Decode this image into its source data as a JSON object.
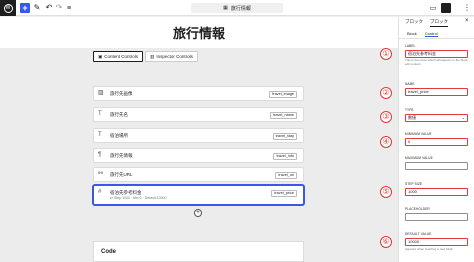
{
  "toolbar": {
    "add_label": "+",
    "document_title": "旅行情報",
    "document_icon": "template-icon"
  },
  "page": {
    "title": "旅行情報"
  },
  "control_tabs": [
    {
      "label": "Content Controls"
    },
    {
      "label": "Inspector Controls"
    }
  ],
  "fields": [
    {
      "label": "旅行先画像",
      "name": "travel_image",
      "icon": "image-icon"
    },
    {
      "label": "旅行先名",
      "name": "travel_name",
      "icon": "text-icon"
    },
    {
      "label": "宿泊場所",
      "name": "travel_stay",
      "icon": "text-icon"
    },
    {
      "label": "旅行先情報",
      "name": "travel_info",
      "icon": "paragraph-icon"
    },
    {
      "label": "旅行先URL",
      "name": "travel_url",
      "icon": "link-icon"
    },
    {
      "label": "宿泊先参考料金",
      "name": "travel_price",
      "icon": "number-icon",
      "sub": "⇄ Step:1000 · Min:0 · Default:10000",
      "selected": true
    }
  ],
  "code_section": {
    "title": "Code"
  },
  "sidebar": {
    "tabs": [
      "ブロック",
      "ブロック"
    ],
    "subtabs": [
      "Block",
      "Control"
    ],
    "label_field": {
      "label": "LABEL",
      "value": "宿泊先参考料金",
      "help": "This is the name which will appear on the block edit content"
    },
    "name_field": {
      "label": "NAME",
      "value": "travel_price"
    },
    "type_field": {
      "label": "TYPE",
      "value": "数値"
    },
    "min_field": {
      "label": "MINIMUM VALUE",
      "value": "0"
    },
    "max_field": {
      "label": "MAXIMUM VALUE",
      "value": ""
    },
    "step_field": {
      "label": "STEP SIZE",
      "value": "1000"
    },
    "placeholder_field": {
      "label": "PLACEHOLDER",
      "value": ""
    },
    "default_field": {
      "label": "DEFAULT VALUE",
      "value": "10000",
      "help": "Appears when inserting a new block"
    }
  },
  "badges": [
    "①",
    "②",
    "③",
    "④",
    "⑤",
    "⑥"
  ],
  "colors": {
    "accent": "#3858e9",
    "highlight": "#e23a3a"
  }
}
